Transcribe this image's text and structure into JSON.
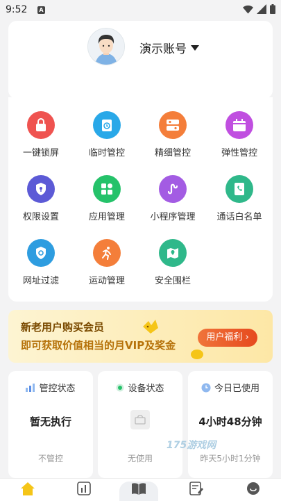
{
  "status_bar": {
    "time": "9:52",
    "badge": "A"
  },
  "profile": {
    "account_name": "演示账号"
  },
  "features": [
    {
      "label": "一键锁屏",
      "color": "#ef5350"
    },
    {
      "label": "临时管控",
      "color": "#29a8e8"
    },
    {
      "label": "精细管控",
      "color": "#f47e3a"
    },
    {
      "label": "弹性管控",
      "color": "#c04fe0"
    },
    {
      "label": "权限设置",
      "color": "#5c5ad6"
    },
    {
      "label": "应用管理",
      "color": "#25c26a"
    },
    {
      "label": "小程序管理",
      "color": "#a35ce3"
    },
    {
      "label": "通话白名单",
      "color": "#2fb88a"
    },
    {
      "label": "网址过滤",
      "color": "#2e9de0"
    },
    {
      "label": "运动管理",
      "color": "#f47e3a"
    },
    {
      "label": "安全围栏",
      "color": "#2fb88a"
    }
  ],
  "banner": {
    "line1": "新老用户购买会员",
    "line2": "即可获取价值相当的月VIP及奖金",
    "button": "用户福利"
  },
  "stats": [
    {
      "title": "管控状态",
      "value": "暂无执行",
      "sub": "不管控"
    },
    {
      "title": "设备状态",
      "value": "",
      "sub": "无使用"
    },
    {
      "title": "今日已使用",
      "value": "4小时48分钟",
      "sub": "昨天5小时1分钟"
    }
  ],
  "watermark": "175游戏网",
  "colors": {
    "accent": "#f5c518",
    "background": "#f3f3f4"
  }
}
